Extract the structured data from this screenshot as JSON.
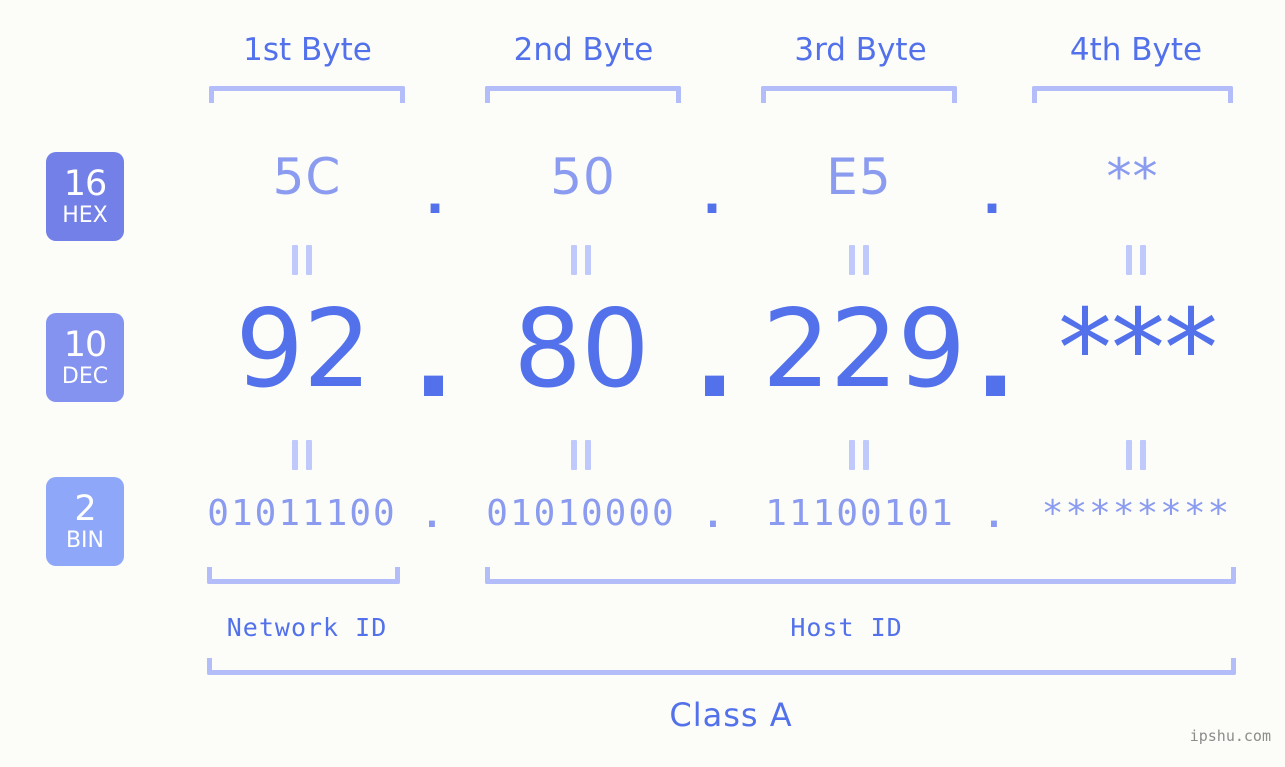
{
  "meta": {
    "watermark": "ipshu.com",
    "background_color": "#fcfdf8",
    "accent_color": "#5271eb",
    "accent_light_color": "#8a9bf0",
    "bracket_color": "#b3bdfa"
  },
  "byte_headers": [
    {
      "label": "1st Byte"
    },
    {
      "label": "2nd Byte"
    },
    {
      "label": "3rd Byte"
    },
    {
      "label": "4th Byte"
    }
  ],
  "rows": [
    {
      "badge_number": "16",
      "badge_name": "HEX",
      "badge_color": "#7280e8",
      "values": [
        "5C",
        "50",
        "E5",
        "**"
      ],
      "separator": "."
    },
    {
      "badge_number": "10",
      "badge_name": "DEC",
      "badge_color": "#8492f0",
      "values": [
        "92",
        "80",
        "229",
        "***"
      ],
      "separator": "."
    },
    {
      "badge_number": "2",
      "badge_name": "BIN",
      "badge_color": "#8ea7f8",
      "values": [
        "01011100",
        "01010000",
        "11100101",
        "********"
      ],
      "separator": "."
    }
  ],
  "equality_marks": {
    "symbol": "||",
    "count_per_row": 4
  },
  "regions": [
    {
      "label": "Network ID"
    },
    {
      "label": "Host ID"
    }
  ],
  "class": {
    "label": "Class A"
  }
}
